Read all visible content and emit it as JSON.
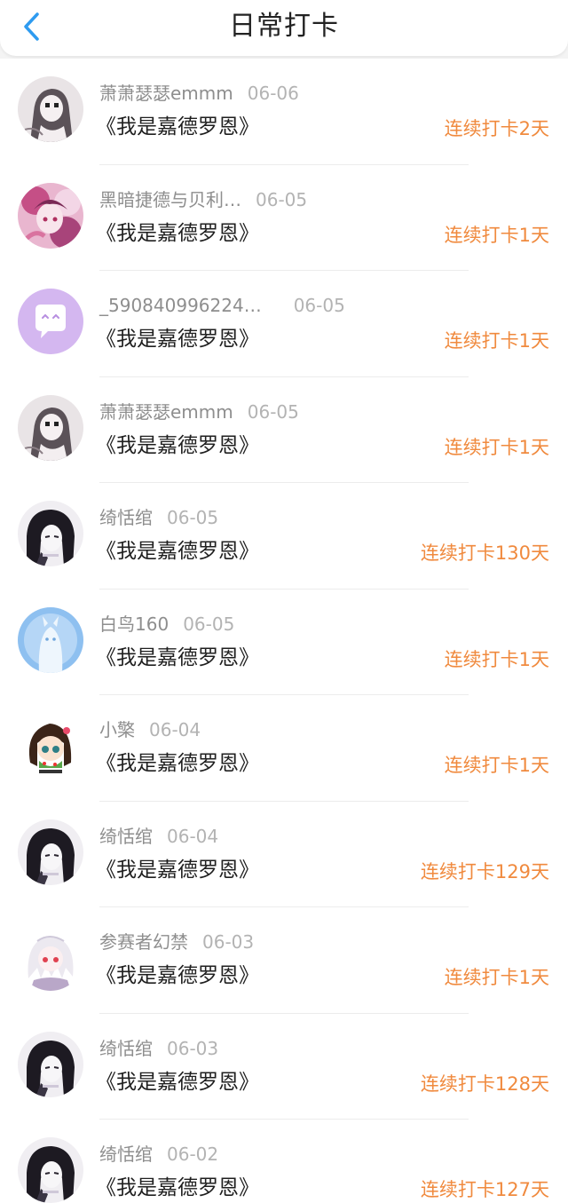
{
  "header": {
    "title": "日常打卡",
    "back_icon": "chevron-left-icon",
    "accent_color": "#2e9bf0"
  },
  "colors": {
    "streak": "#f08a3e",
    "username": "#8e8e8e",
    "date": "#b3b3b3"
  },
  "checkins": [
    {
      "user": "萧萧瑟瑟emmm",
      "date": "06-06",
      "book": "《我是嘉德罗恩》",
      "streak": "连续打卡2天",
      "avatar": "avatar-sketch-girl"
    },
    {
      "user": "黑暗捷德与贝利…",
      "date": "06-05",
      "book": "《我是嘉德罗恩》",
      "streak": "连续打卡1天",
      "avatar": "avatar-pink-anime"
    },
    {
      "user": "_590840996224…",
      "date": "06-05",
      "book": "《我是嘉德罗恩》",
      "streak": "连续打卡1天",
      "avatar": "avatar-default-purple"
    },
    {
      "user": "萧萧瑟瑟emmm",
      "date": "06-05",
      "book": "《我是嘉德罗恩》",
      "streak": "连续打卡1天",
      "avatar": "avatar-sketch-girl"
    },
    {
      "user": "绮恬绾",
      "date": "06-05",
      "book": "《我是嘉德罗恩》",
      "streak": "连续打卡130天",
      "avatar": "avatar-dark-hair"
    },
    {
      "user": "白鸟160",
      "date": "06-05",
      "book": "《我是嘉德罗恩》",
      "streak": "连续打卡1天",
      "avatar": "avatar-blue-ghost"
    },
    {
      "user": "小檠",
      "date": "06-04",
      "book": "《我是嘉德罗恩》",
      "streak": "连续打卡1天",
      "avatar": "avatar-chibi-girl"
    },
    {
      "user": "绮恬绾",
      "date": "06-04",
      "book": "《我是嘉德罗恩》",
      "streak": "连续打卡129天",
      "avatar": "avatar-dark-hair"
    },
    {
      "user": "参赛者幻禁",
      "date": "06-03",
      "book": "《我是嘉德罗恩》",
      "streak": "连续打卡1天",
      "avatar": "avatar-white-hair"
    },
    {
      "user": "绮恬绾",
      "date": "06-03",
      "book": "《我是嘉德罗恩》",
      "streak": "连续打卡128天",
      "avatar": "avatar-dark-hair"
    },
    {
      "user": "绮恬绾",
      "date": "06-02",
      "book": "《我是嘉德罗恩》",
      "streak": "连续打卡127天",
      "avatar": "avatar-dark-hair"
    }
  ]
}
